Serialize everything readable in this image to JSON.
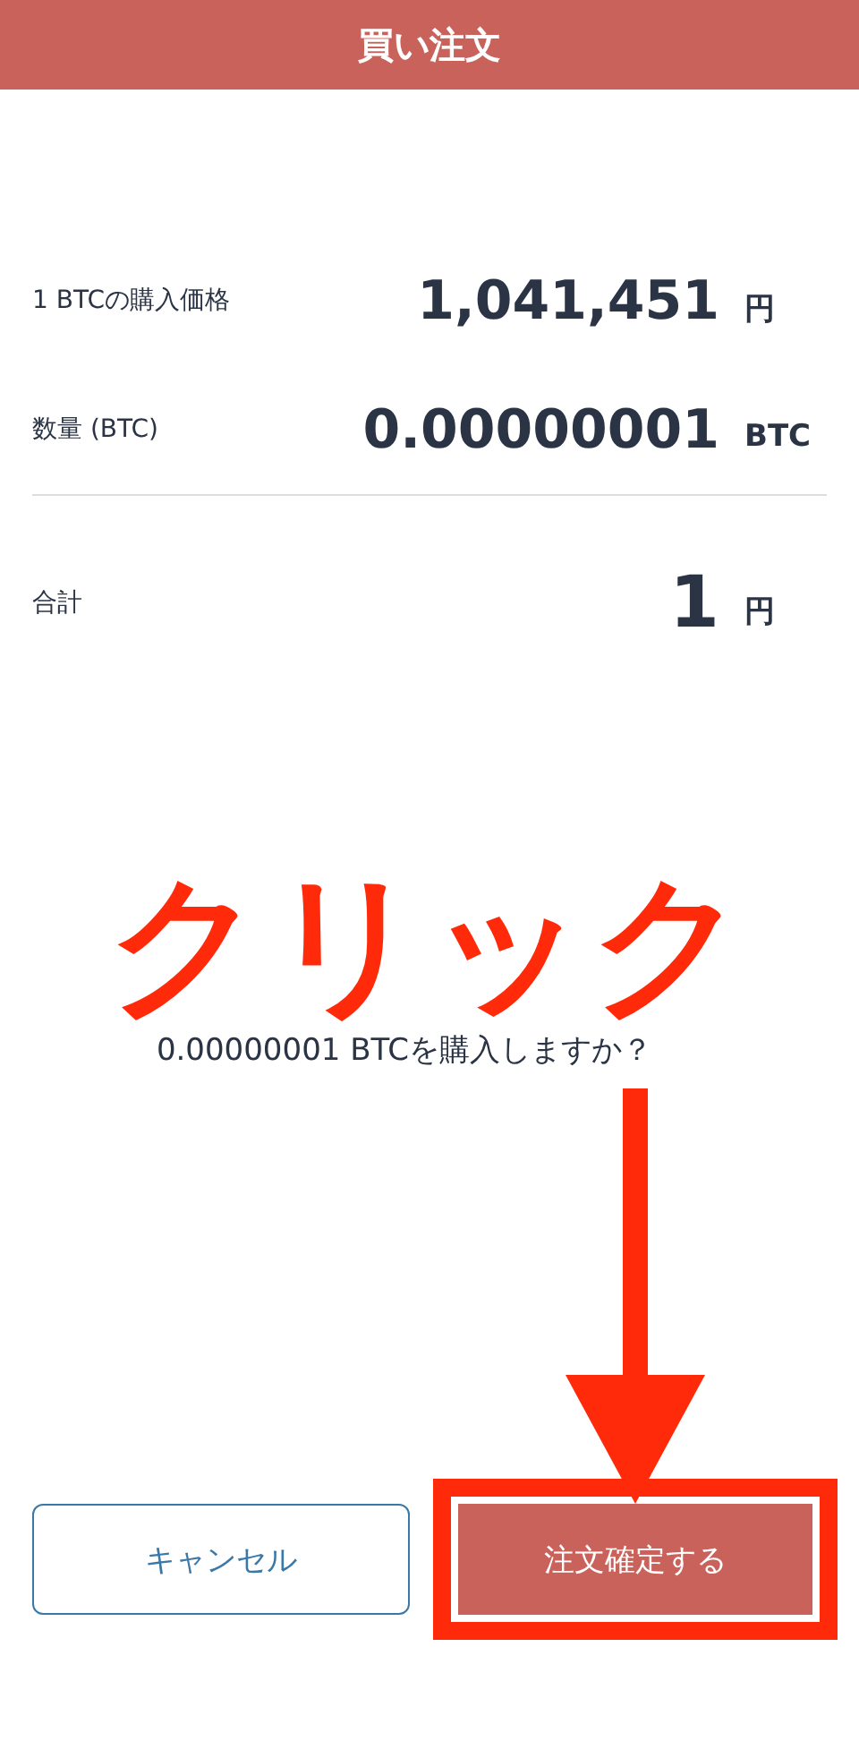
{
  "header": {
    "title": "買い注文"
  },
  "rows": [
    {
      "label": "1 BTCの購入価格",
      "value": "1,041,451",
      "unit": "円"
    },
    {
      "label": "数量 (BTC)",
      "value": "0.00000001",
      "unit": "BTC"
    },
    {
      "label": "合計",
      "value": "1",
      "unit": "円"
    }
  ],
  "annotation": {
    "text": "クリック"
  },
  "question": "0.00000001 BTCを購入しますか？",
  "buttons": [
    {
      "label": "キャンセル",
      "kind": "outline"
    },
    {
      "label": "注文確定する",
      "kind": "primary",
      "highlighted": true
    }
  ]
}
